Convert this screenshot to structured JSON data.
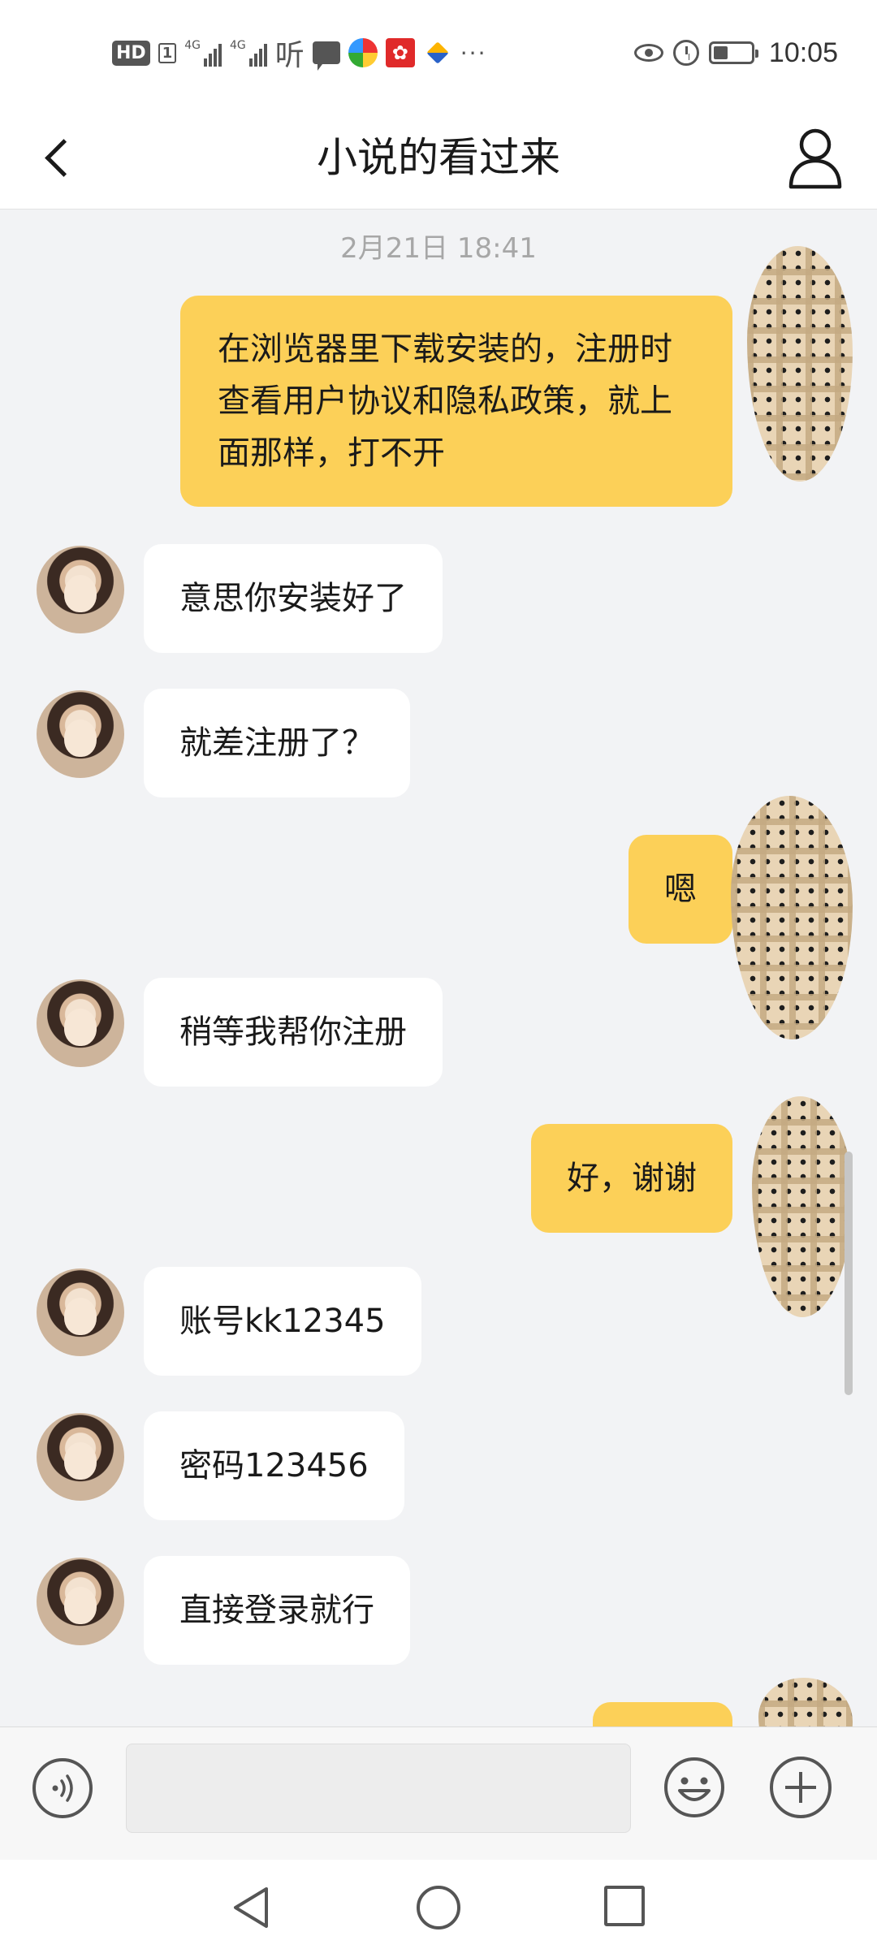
{
  "status_bar": {
    "hd": "HD",
    "sim_slot": "1",
    "network_1": "4G",
    "network_2": "4G",
    "ting_icon": "听",
    "clock": "10:05",
    "battery_level": 0.35,
    "icons": [
      "hd-icon",
      "signal-icon",
      "signal-icon",
      "ting-icon",
      "message-icon",
      "app-icon",
      "gift-app-icon",
      "plane-app-icon",
      "more-icon",
      "eye-icon",
      "alarm-icon",
      "battery-icon"
    ]
  },
  "header": {
    "title": "小说的看过来",
    "back_icon": "back-arrow-icon",
    "profile_icon": "user-profile-icon"
  },
  "chat": {
    "timestamp": "2月21日 18:41",
    "messages": [
      {
        "side": "out",
        "text": "在浏览器里下载安装的，注册时查看用户协议和隐私政策，就上面那样，打不开"
      },
      {
        "side": "in",
        "text": "意思你安装好了"
      },
      {
        "side": "in",
        "text": "就差注册了？"
      },
      {
        "side": "out",
        "text": "嗯"
      },
      {
        "side": "in",
        "text": "稍等我帮你注册"
      },
      {
        "side": "out",
        "text": "好，谢谢"
      },
      {
        "side": "in",
        "text": "账号kk12345"
      },
      {
        "side": "in",
        "text": "密码123456"
      },
      {
        "side": "in",
        "text": "直接登录就行"
      },
      {
        "side": "out",
        "text": ""
      }
    ]
  },
  "input_bar": {
    "value": "",
    "placeholder": "",
    "voice_icon": "voice-icon",
    "emoji_icon": "emoji-icon",
    "plus_icon": "plus-icon"
  },
  "nav_bar": {
    "icons": [
      "nav-back-icon",
      "nav-home-icon",
      "nav-recent-icon"
    ]
  },
  "colors": {
    "outgoing_bubble": "#fcd058",
    "incoming_bubble": "#ffffff",
    "chat_background": "#f2f3f5",
    "timestamp_text": "#a7a7a7"
  }
}
